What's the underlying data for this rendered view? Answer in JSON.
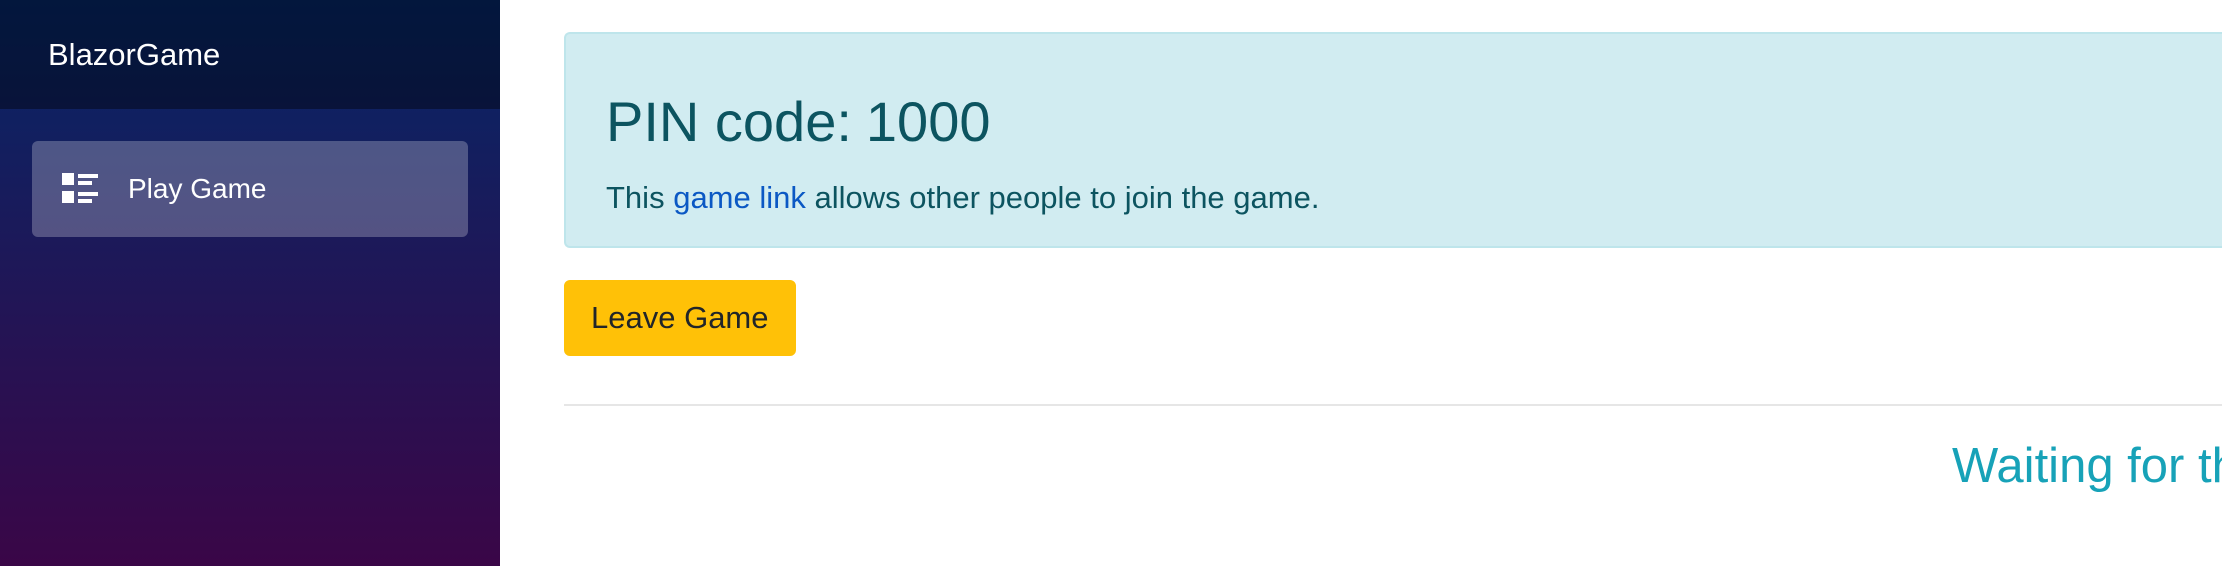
{
  "sidebar": {
    "brand": "BlazorGame",
    "items": [
      {
        "label": "Play Game",
        "icon": "list-rich-icon"
      }
    ]
  },
  "alert": {
    "pin_label": "PIN code:",
    "pin_value": "1000",
    "text_before": "This",
    "link_text": "game link",
    "text_after": "allows other people to join the game."
  },
  "actions": {
    "leave_label": "Leave Game"
  },
  "status": {
    "message": "Waiting for the game to start."
  },
  "colors": {
    "sidebar_top": "#052767",
    "sidebar_bottom": "#3a0647",
    "alert_bg": "#d1ecf1",
    "alert_text": "#0c5460",
    "link": "#0b58c4",
    "leave_button": "#ffc107",
    "status_text": "#17a2b8"
  }
}
